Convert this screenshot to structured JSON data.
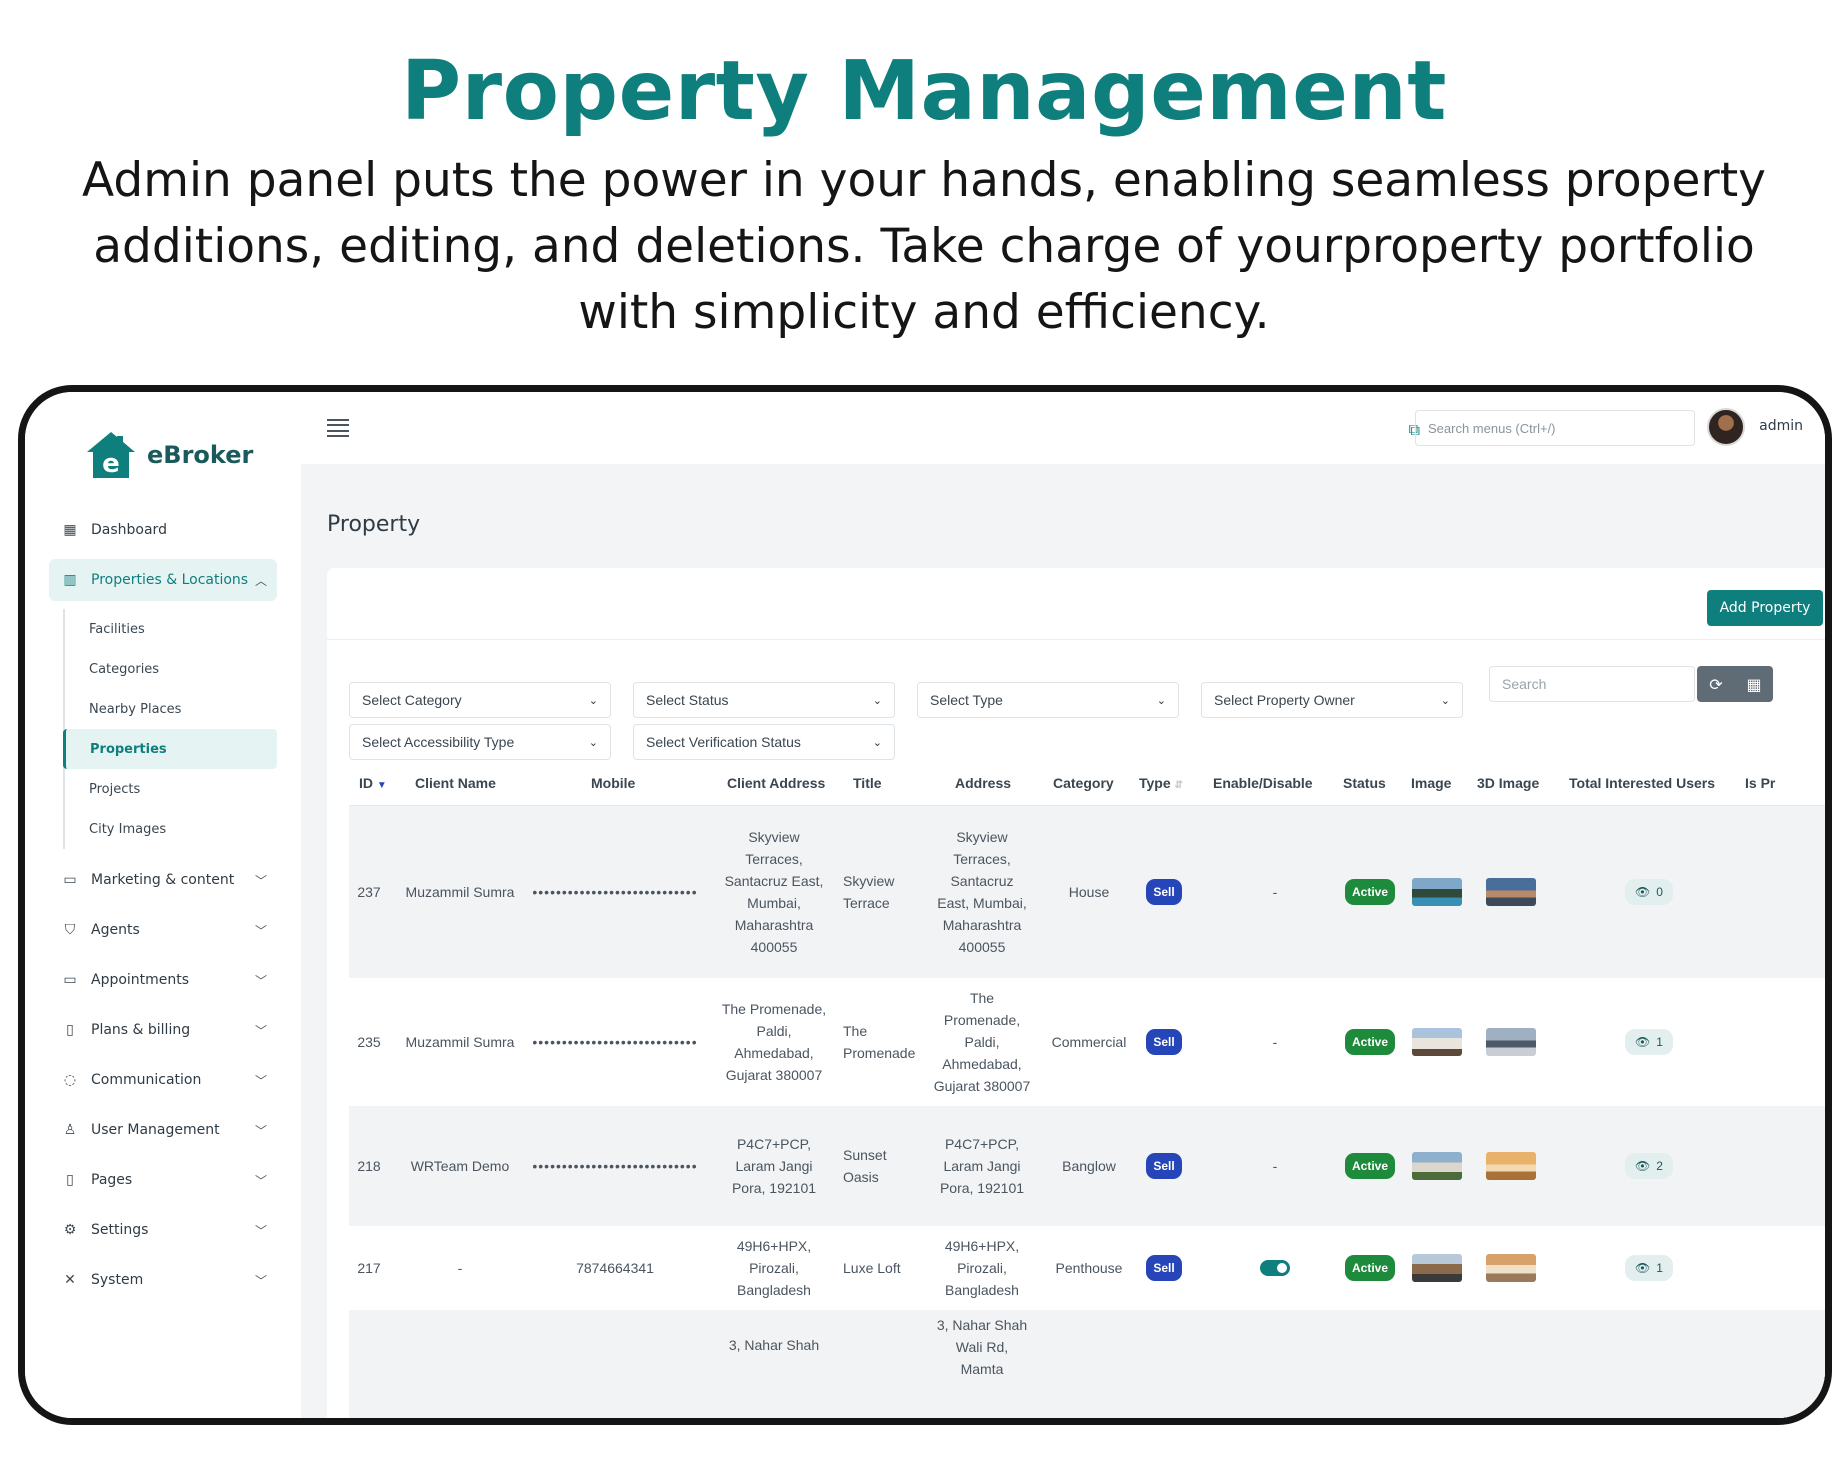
{
  "hero": {
    "title": "Property Management",
    "text": "Admin panel puts the power in your hands, enabling seamless property additions, editing, and deletions. Take charge of yourproperty portfolio with simplicity and efficiency."
  },
  "brand": {
    "name": "eBroker"
  },
  "sidebar": {
    "items": [
      {
        "label": "Dashboard",
        "icon": "grid-icon"
      },
      {
        "label": "Properties & Locations",
        "icon": "chart-icon",
        "expanded": true,
        "children": [
          "Facilities",
          "Categories",
          "Nearby Places",
          "Properties",
          "Projects",
          "City Images"
        ],
        "active_child": "Properties"
      },
      {
        "label": "Marketing & content",
        "icon": "ad-icon"
      },
      {
        "label": "Agents",
        "icon": "shield-icon"
      },
      {
        "label": "Appointments",
        "icon": "calendar-icon"
      },
      {
        "label": "Plans & billing",
        "icon": "document-icon"
      },
      {
        "label": "Communication",
        "icon": "chat-icon"
      },
      {
        "label": "User Management",
        "icon": "user-icon"
      },
      {
        "label": "Pages",
        "icon": "page-icon"
      },
      {
        "label": "Settings",
        "icon": "gear-icon"
      },
      {
        "label": "System",
        "icon": "tools-icon"
      }
    ]
  },
  "topbar": {
    "search_placeholder": "Search menus (Ctrl+/)",
    "user": "admin"
  },
  "page": {
    "title": "Property",
    "add_button": "Add Property",
    "filters": {
      "category": "Select Category",
      "status": "Select Status",
      "type": "Select Type",
      "owner": "Select Property Owner",
      "accessibility": "Select Accessibility Type",
      "verification": "Select Verification Status"
    },
    "search_placeholder": "Search"
  },
  "table": {
    "columns": [
      "ID",
      "Client Name",
      "Mobile",
      "Client Address",
      "Title",
      "Address",
      "Category",
      "Type",
      "Enable/Disable",
      "Status",
      "Image",
      "3D Image",
      "Total Interested Users",
      "Is Pr"
    ],
    "rows": [
      {
        "id": "237",
        "client": "Muzammil Sumra",
        "mobile": "••••••••••••••••••••••••••••",
        "client_address": "Skyview Terraces, Santacruz East, Mumbai, Maharashtra 400055",
        "title": "Skyview Terrace",
        "address": "Skyview Terraces, Santacruz East, Mumbai, Maharashtra 400055",
        "category": "House",
        "type": "Sell",
        "enable": "-",
        "status": "Active",
        "interested": "0"
      },
      {
        "id": "235",
        "client": "Muzammil Sumra",
        "mobile": "••••••••••••••••••••••••••••",
        "client_address": "The Promenade, Paldi, Ahmedabad, Gujarat 380007",
        "title": "The Promenade",
        "address": "The Promenade, Paldi, Ahmedabad, Gujarat 380007",
        "category": "Commercial",
        "type": "Sell",
        "enable": "-",
        "status": "Active",
        "interested": "1"
      },
      {
        "id": "218",
        "client": "WRTeam Demo",
        "mobile": "••••••••••••••••••••••••••••",
        "client_address": "P4C7+PCP, Laram Jangi Pora, 192101",
        "title": "Sunset Oasis",
        "address": "P4C7+PCP, Laram Jangi Pora, 192101",
        "category": "Banglow",
        "type": "Sell",
        "enable": "-",
        "status": "Active",
        "interested": "2"
      },
      {
        "id": "217",
        "client": "-",
        "mobile": "7874664341",
        "client_address": "49H6+HPX, Pirozali, Bangladesh",
        "title": "Luxe Loft",
        "address": "49H6+HPX, Pirozali, Bangladesh",
        "category": "Penthouse",
        "type": "Sell",
        "enable": "toggle-on",
        "status": "Active",
        "interested": "1"
      },
      {
        "id": "",
        "client": "",
        "mobile": "",
        "client_address": "3, Nahar Shah",
        "title": "",
        "address": "3, Nahar Shah Wali Rd, Mamta",
        "category": "",
        "type": "",
        "enable": "",
        "status": "",
        "interested": ""
      }
    ]
  },
  "colors": {
    "brand": "#0f7f7d",
    "sell": "#2545b8",
    "active": "#1e8a3c"
  }
}
